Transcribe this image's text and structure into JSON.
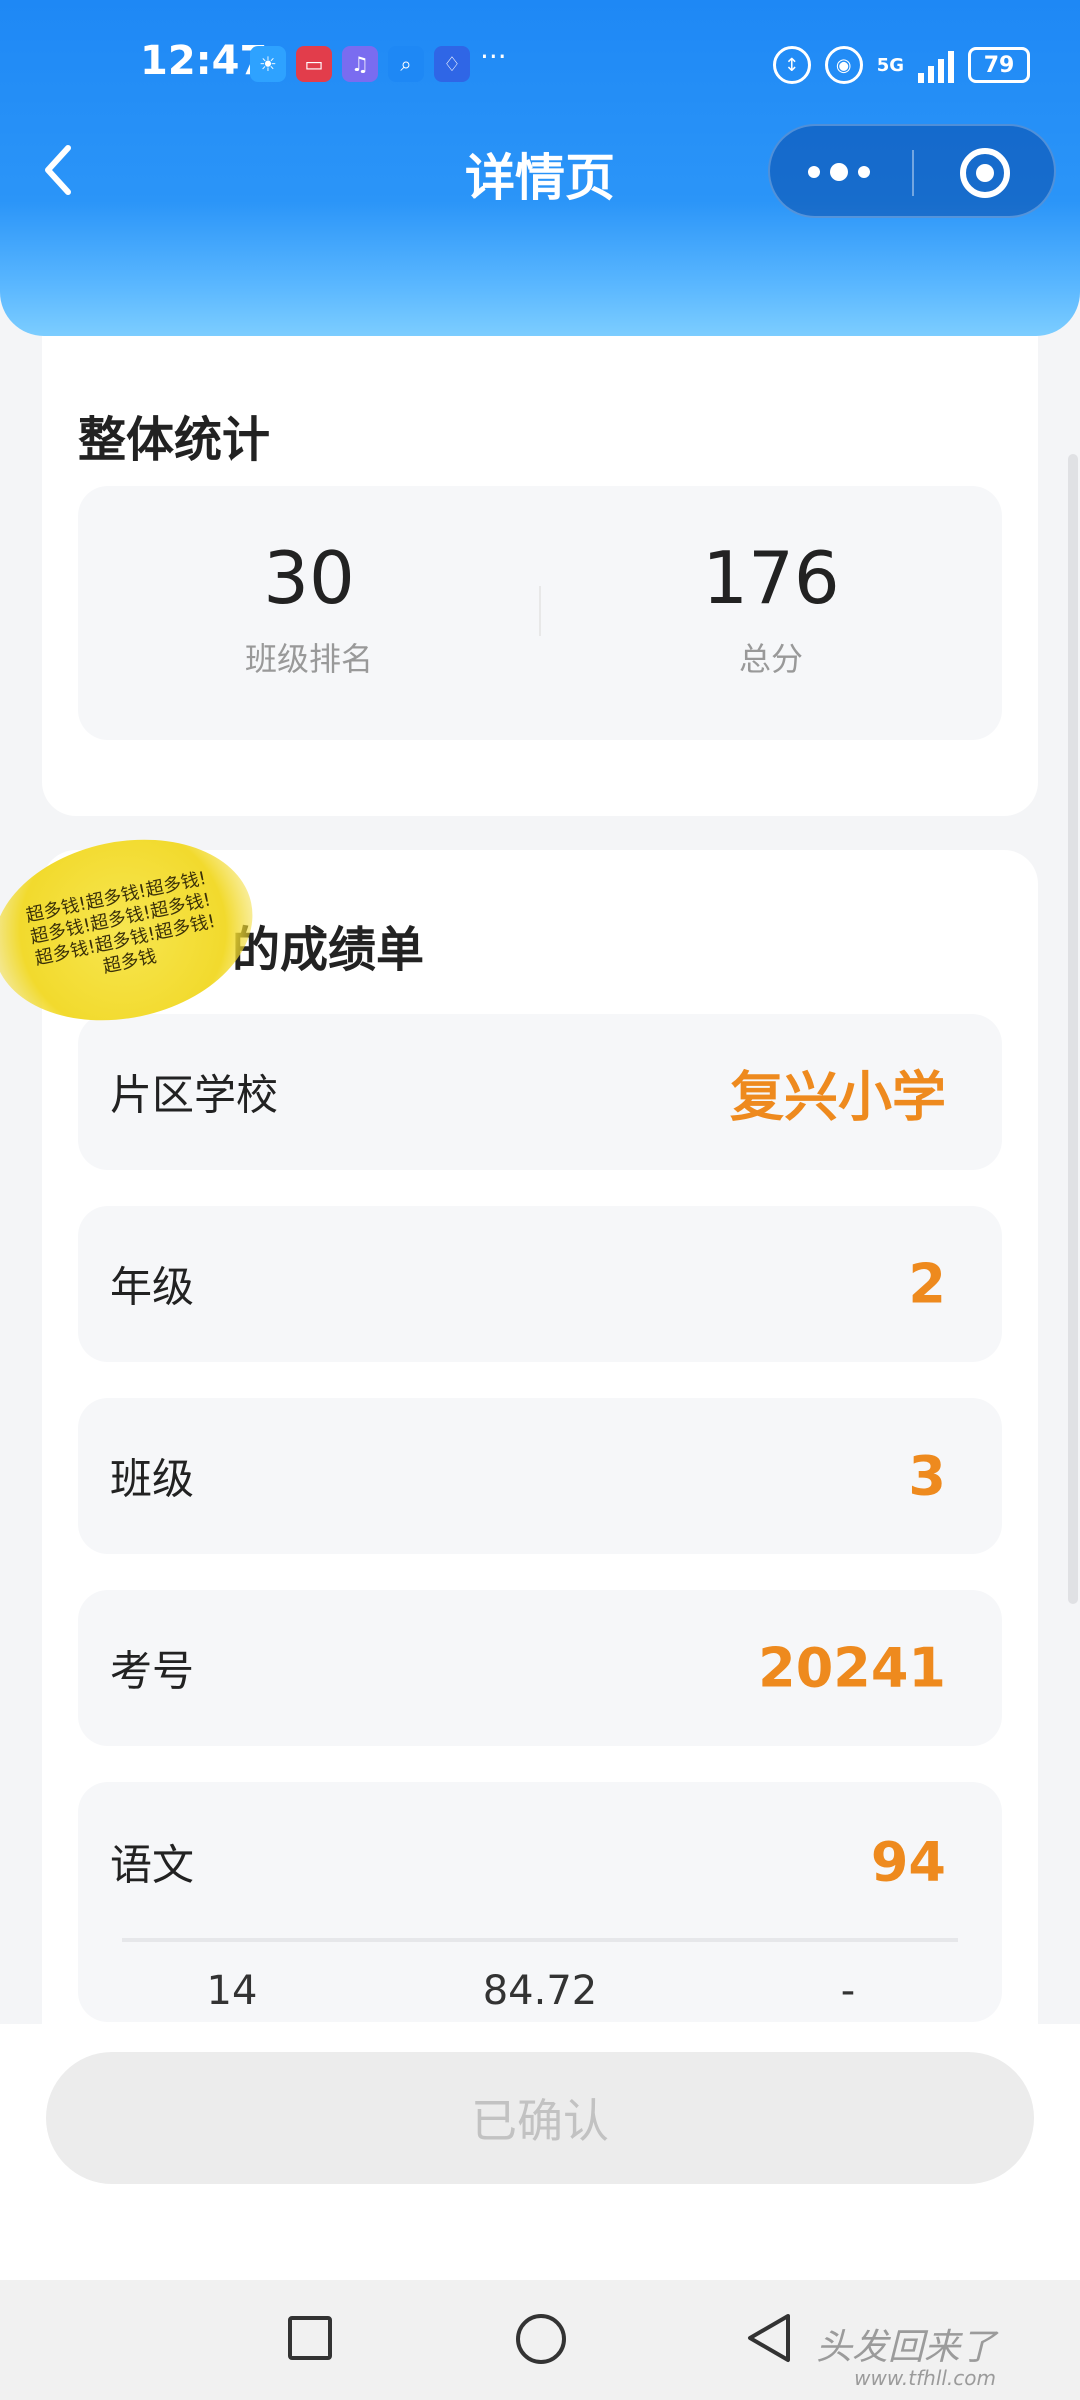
{
  "status_bar": {
    "time": "12:47",
    "more_dots": "···",
    "network": "5G",
    "battery": "79"
  },
  "nav": {
    "title": "详情页"
  },
  "overall": {
    "title": "整体统计",
    "stats": [
      {
        "value": "30",
        "label": "班级排名"
      },
      {
        "value": "176",
        "label": "总分"
      }
    ]
  },
  "report": {
    "title": "的成绩单",
    "sticker_text": "超多钱",
    "rows": [
      {
        "label": "片区学校",
        "value": "复兴小学"
      },
      {
        "label": "年级",
        "value": "2"
      },
      {
        "label": "班级",
        "value": "3"
      },
      {
        "label": "考号",
        "value": "20241"
      }
    ],
    "subject": {
      "label": "语文",
      "value": "94",
      "details": [
        "14",
        "84.72",
        "-"
      ]
    }
  },
  "confirm_button": "已确认",
  "watermark": {
    "text": "头发回来了",
    "url": "www.tfhll.com"
  },
  "colors": {
    "accent": "#ee8a1e",
    "header_blue": "#1e88f5"
  }
}
